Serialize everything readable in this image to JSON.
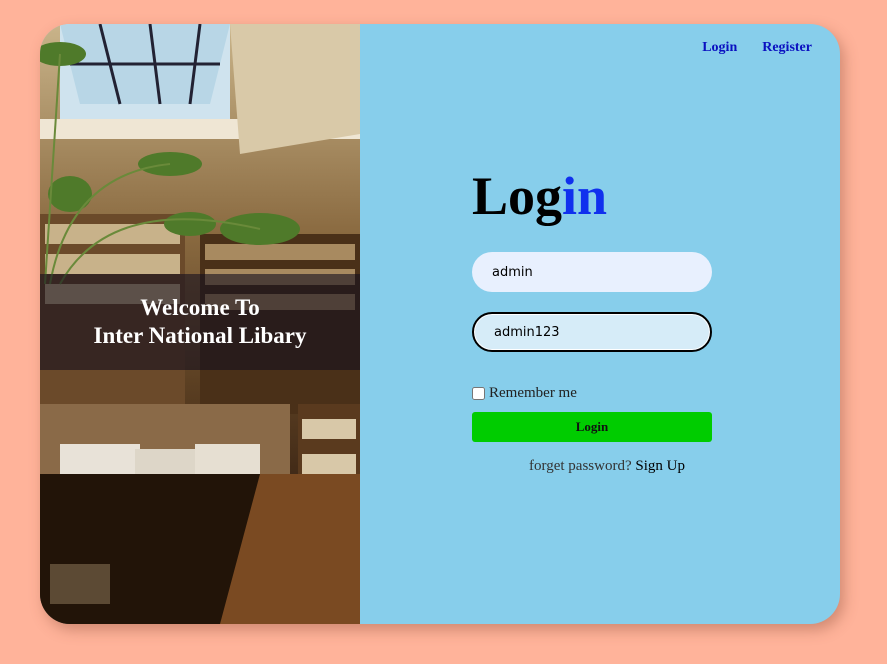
{
  "nav": {
    "login_label": "Login",
    "register_label": "Register"
  },
  "hero": {
    "welcome_line1": "Welcome To",
    "welcome_line2": "Inter National Libary"
  },
  "form": {
    "title_black": "Log",
    "title_blue": "in",
    "username_value": "admin",
    "password_value": "admin123",
    "remember_label": "Remember me",
    "remember_checked": false,
    "submit_label": "Login",
    "forget_text": "forget password?",
    "signup_label": "Sign Up"
  },
  "colors": {
    "page_bg": "#ffb39a",
    "panel_bg": "#87ceeb",
    "accent_blue": "#1030ee",
    "button_green": "#00cc00",
    "nav_link": "#0a10c0"
  }
}
